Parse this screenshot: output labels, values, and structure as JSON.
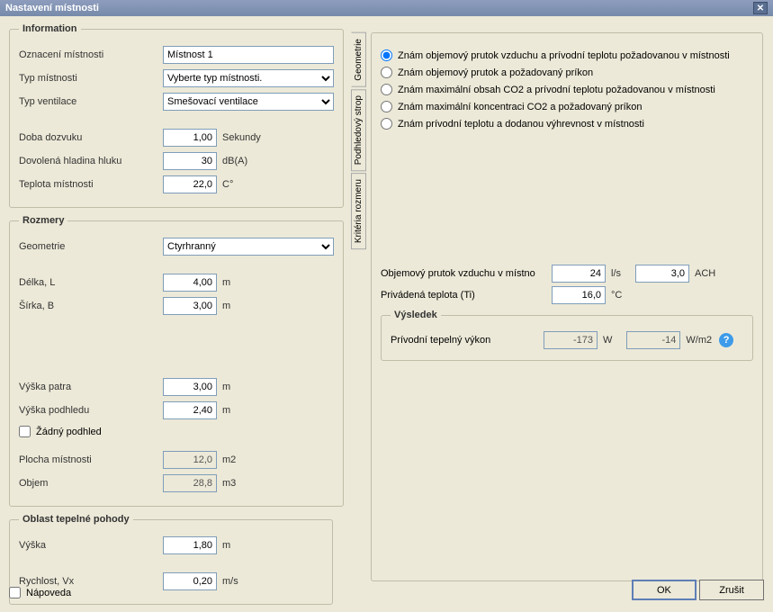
{
  "title": "Nastavení místnosti",
  "left": {
    "info": {
      "legend": "Information",
      "roomDesign": {
        "label": "Oznacení místnosti",
        "value": "Místnost 1"
      },
      "roomType": {
        "label": "Typ místnosti",
        "value": "Vyberte typ místnosti."
      },
      "ventType": {
        "label": "Typ ventilace",
        "value": "Smešovací ventilace"
      },
      "reverb": {
        "label": "Doba dozvuku",
        "value": "1,00",
        "unit": "Sekundy"
      },
      "noise": {
        "label": "Dovolená hladina hluku",
        "value": "30",
        "unit": "dB(A)"
      },
      "temp": {
        "label": "Teplota místnosti",
        "value": "22,0",
        "unit": "C°"
      }
    },
    "dim": {
      "legend": "Rozmery",
      "geom": {
        "label": "Geometrie",
        "value": "Ctyrhranný"
      },
      "len": {
        "label": "Délka, L",
        "value": "4,00",
        "unit": "m"
      },
      "wid": {
        "label": "Šírka, B",
        "value": "3,00",
        "unit": "m"
      },
      "floorH": {
        "label": "Výška patra",
        "value": "3,00",
        "unit": "m"
      },
      "ceilH": {
        "label": "Výška podhledu",
        "value": "2,40",
        "unit": "m"
      },
      "noCeil": {
        "label": "Žádný podhled"
      },
      "area": {
        "label": "Plocha místnosti",
        "value": "12,0",
        "unit": "m2"
      },
      "vol": {
        "label": "Objem",
        "value": "28,8",
        "unit": "m3"
      }
    },
    "comfort": {
      "legend": "Oblast tepelné pohody",
      "height": {
        "label": "Výška",
        "value": "1,80",
        "unit": "m"
      },
      "vel": {
        "label": "Rychlost, Vx",
        "value": "0,20",
        "unit": "m/s"
      }
    }
  },
  "tabs": {
    "t1": "Geometrie",
    "t2": "Podhledový strop",
    "t3": "Kritéria rozmeru"
  },
  "right": {
    "radios": {
      "r1": "Znám objemový prutok vzduchu a prívodní teplotu požadovanou v místnosti",
      "r2": "Znám objemový prutok a požadovaný príkon",
      "r3": "Znám maximální obsah CO2 a prívodní teplotu požadovanou v místnosti",
      "r4": "Znám maximální koncentraci CO2 a požadovaný príkon",
      "r5": "Znám prívodní teplotu a dodanou výhrevnost v místnosti"
    },
    "flow": {
      "label": "Objemový prutok vzduchu v místno",
      "v1": "24",
      "u1": "l/s",
      "v2": "3,0",
      "u2": "ACH"
    },
    "ti": {
      "label": "Privádená teplota (Ti)",
      "value": "16,0",
      "unit": "°C"
    },
    "result": {
      "legend": "Výsledek",
      "row": {
        "label": "Prívodní tepelný výkon",
        "v1": "-173",
        "u1": "W",
        "v2": "-14",
        "u2": "W/m2"
      }
    }
  },
  "bottom": {
    "help": "Nápoveda",
    "ok": "OK",
    "cancel": "Zrušit"
  }
}
